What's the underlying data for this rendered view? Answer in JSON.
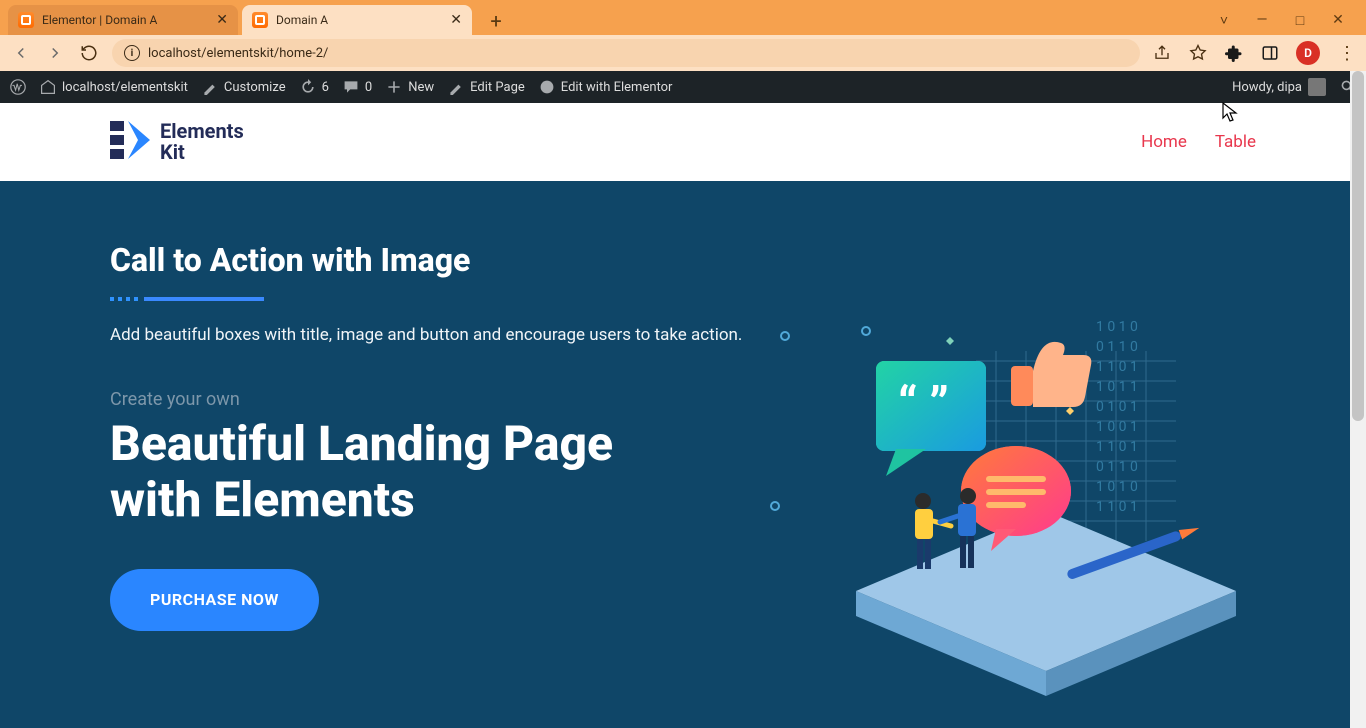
{
  "window": {
    "tabs": [
      {
        "title": "Elementor | Domain A",
        "active": false
      },
      {
        "title": "Domain A",
        "active": true
      }
    ],
    "controls": {
      "min": "—",
      "max": "□",
      "close": "✕"
    },
    "newtab_hint": "+"
  },
  "toolbar": {
    "url": "localhost/elementskit/home-2/",
    "avatar_letter": "D"
  },
  "wp_admin_bar": {
    "site": "localhost/elementskit",
    "customize": "Customize",
    "updates_count": "6",
    "comments_count": "0",
    "new": "New",
    "edit_page": "Edit Page",
    "edit_elementor": "Edit with Elementor",
    "howdy": "Howdy, dipa"
  },
  "site": {
    "logo_line1": "Elements",
    "logo_line2": "Kit",
    "nav": [
      {
        "label": "Home"
      },
      {
        "label": "Table"
      }
    ]
  },
  "hero": {
    "cta_heading": "Call to Action with Image",
    "cta_desc": "Add beautiful boxes with title, image and button and encourage users to take action.",
    "pretitle": "Create your own",
    "title_line1": "Beautiful Landing Page",
    "title_line2": "with Elements",
    "button": "PURCHASE NOW"
  }
}
